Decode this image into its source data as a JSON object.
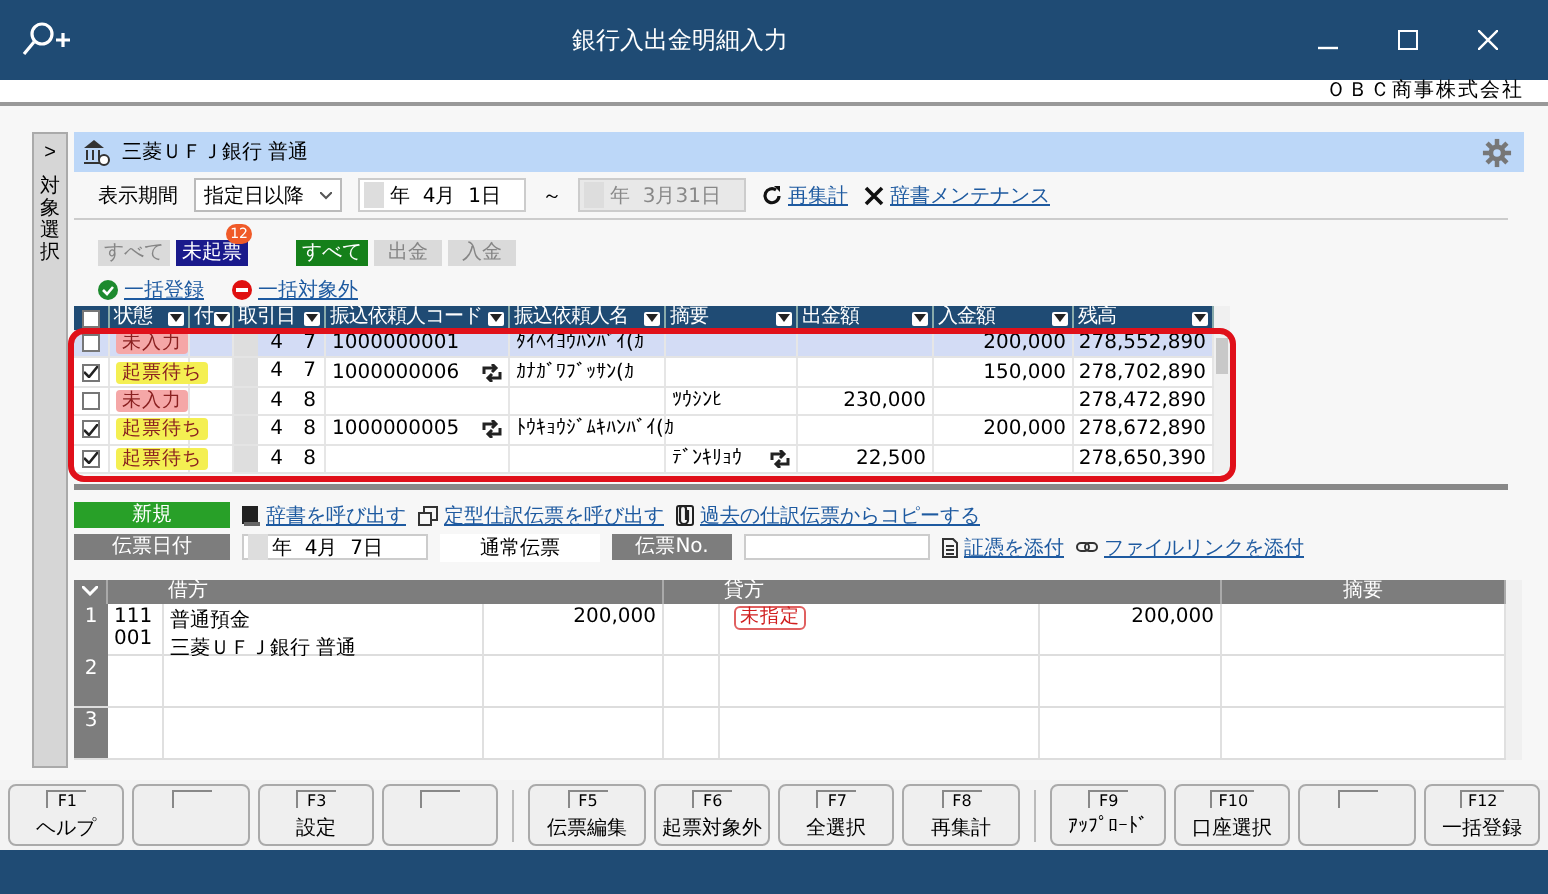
{
  "window": {
    "title": "銀行入出金明細入力"
  },
  "company": "ＯＢＣ商事株式会社",
  "side_panel": {
    "toggle": ">",
    "label": "対象選択"
  },
  "account": {
    "name": "三菱ＵＦＪ銀行 普通"
  },
  "filter": {
    "period_label": "表示期間",
    "period_mode": "指定日以降",
    "from": "年  4月  1日",
    "tilde": "～",
    "to": "年  3月31日",
    "recalc": "再集計",
    "dictionary": "辞書メンテナンス"
  },
  "status_filters": [
    {
      "label": "すべて",
      "selected": false
    },
    {
      "label": "未起票",
      "selected": true,
      "badge": "12"
    }
  ],
  "type_filters": [
    {
      "label": "すべて",
      "selected": true
    },
    {
      "label": "出金",
      "selected": false
    },
    {
      "label": "入金",
      "selected": false
    }
  ],
  "bulk_actions": [
    {
      "label": "一括登録",
      "kind": "register"
    },
    {
      "label": "一括対象外",
      "kind": "exclude"
    }
  ],
  "table": {
    "all_checked": false,
    "columns": [
      "状態",
      "付",
      "取引日",
      "振込依頼人コード",
      "振込依頼人名",
      "摘要",
      "出金額",
      "入金額",
      "残高"
    ],
    "rows": [
      {
        "checked": false,
        "selected": true,
        "status": "未入力",
        "color": "#f5a7a7",
        "month": "4",
        "day": "7",
        "code": "1000000001",
        "code_repeat": false,
        "name": "ﾀｲﾍｲﾖｳﾊﾝﾊﾞｲ(ｶ",
        "summary_repeat": false,
        "deposit": "200,000",
        "balance": "278,552,890"
      },
      {
        "checked": true,
        "selected": false,
        "status": "起票待ち",
        "color": "#f4ef52",
        "month": "4",
        "day": "7",
        "code": "1000000006",
        "code_repeat": true,
        "name": "ｶﾅｶﾞﾜﾌﾞｯｻﾝ(ｶ",
        "summary_repeat": false,
        "deposit": "150,000",
        "balance": "278,702,890"
      },
      {
        "checked": false,
        "selected": false,
        "status": "未入力",
        "color": "#f5a7a7",
        "month": "4",
        "day": "8",
        "code_repeat": false,
        "summary": "ﾂｳｼﾝﾋ",
        "summary_repeat": false,
        "withdrawal": "230,000",
        "balance": "278,472,890"
      },
      {
        "checked": true,
        "selected": false,
        "status": "起票待ち",
        "color": "#f4ef52",
        "month": "4",
        "day": "8",
        "code": "1000000005",
        "code_repeat": true,
        "name": "ﾄｳｷｮｳｼﾞﾑｷﾊﾝﾊﾞｲ(ｶ",
        "summary_repeat": false,
        "deposit": "200,000",
        "balance": "278,672,890"
      },
      {
        "checked": true,
        "selected": false,
        "status": "起票待ち",
        "color": "#f4ef52",
        "month": "4",
        "day": "8",
        "code_repeat": false,
        "summary": "ﾃﾞﾝｷﾘｮｳ",
        "summary_repeat": true,
        "withdrawal": "22,500",
        "balance": "278,650,390"
      }
    ]
  },
  "journal": {
    "mode": "新規",
    "links": [
      {
        "label": "辞書を呼び出す",
        "kind": "book"
      },
      {
        "label": "定型仕訳伝票を呼び出す",
        "kind": "copy"
      },
      {
        "label": "過去の仕訳伝票からコピーする",
        "kind": "clip"
      }
    ],
    "date_label": "伝票日付",
    "date": "年  4月  7日",
    "type": "通常伝票",
    "no_label": "伝票No.",
    "attach_links": [
      {
        "label": "証憑を添付",
        "kind": "doc"
      },
      {
        "label": "ファイルリンクを添付",
        "kind": "link"
      }
    ],
    "headers": [
      "借方",
      "貸方",
      "摘要"
    ],
    "rows": [
      {
        "number": "1",
        "debit_code": "111",
        "debit_sub_code": "001",
        "debit_account": "普通預金",
        "debit_sub": "三菱ＵＦＪ銀行 普通",
        "debit_amount": "200,000",
        "credit_tag": "未指定",
        "credit_amount": "200,000"
      },
      {
        "number": "2"
      },
      {
        "number": "3"
      }
    ]
  },
  "function_keys": [
    {
      "kind": "key",
      "key": "F1",
      "label": "ヘルプ"
    },
    {
      "kind": "blank"
    },
    {
      "kind": "key",
      "key": "F3",
      "label": "設定"
    },
    {
      "kind": "blank"
    },
    {
      "kind": "key",
      "key": "F5",
      "label": "伝票編集"
    },
    {
      "kind": "key",
      "key": "F6",
      "label": "起票対象外"
    },
    {
      "kind": "key",
      "key": "F7",
      "label": "全選択"
    },
    {
      "kind": "key",
      "key": "F8",
      "label": "再集計"
    },
    {
      "kind": "key",
      "key": "F9",
      "label": "ｱｯﾌﾟﾛｰﾄﾞ"
    },
    {
      "kind": "key",
      "key": "F10",
      "label": "口座選択"
    },
    {
      "kind": "blank"
    },
    {
      "kind": "key",
      "key": "F12",
      "label": "一括登録"
    }
  ]
}
